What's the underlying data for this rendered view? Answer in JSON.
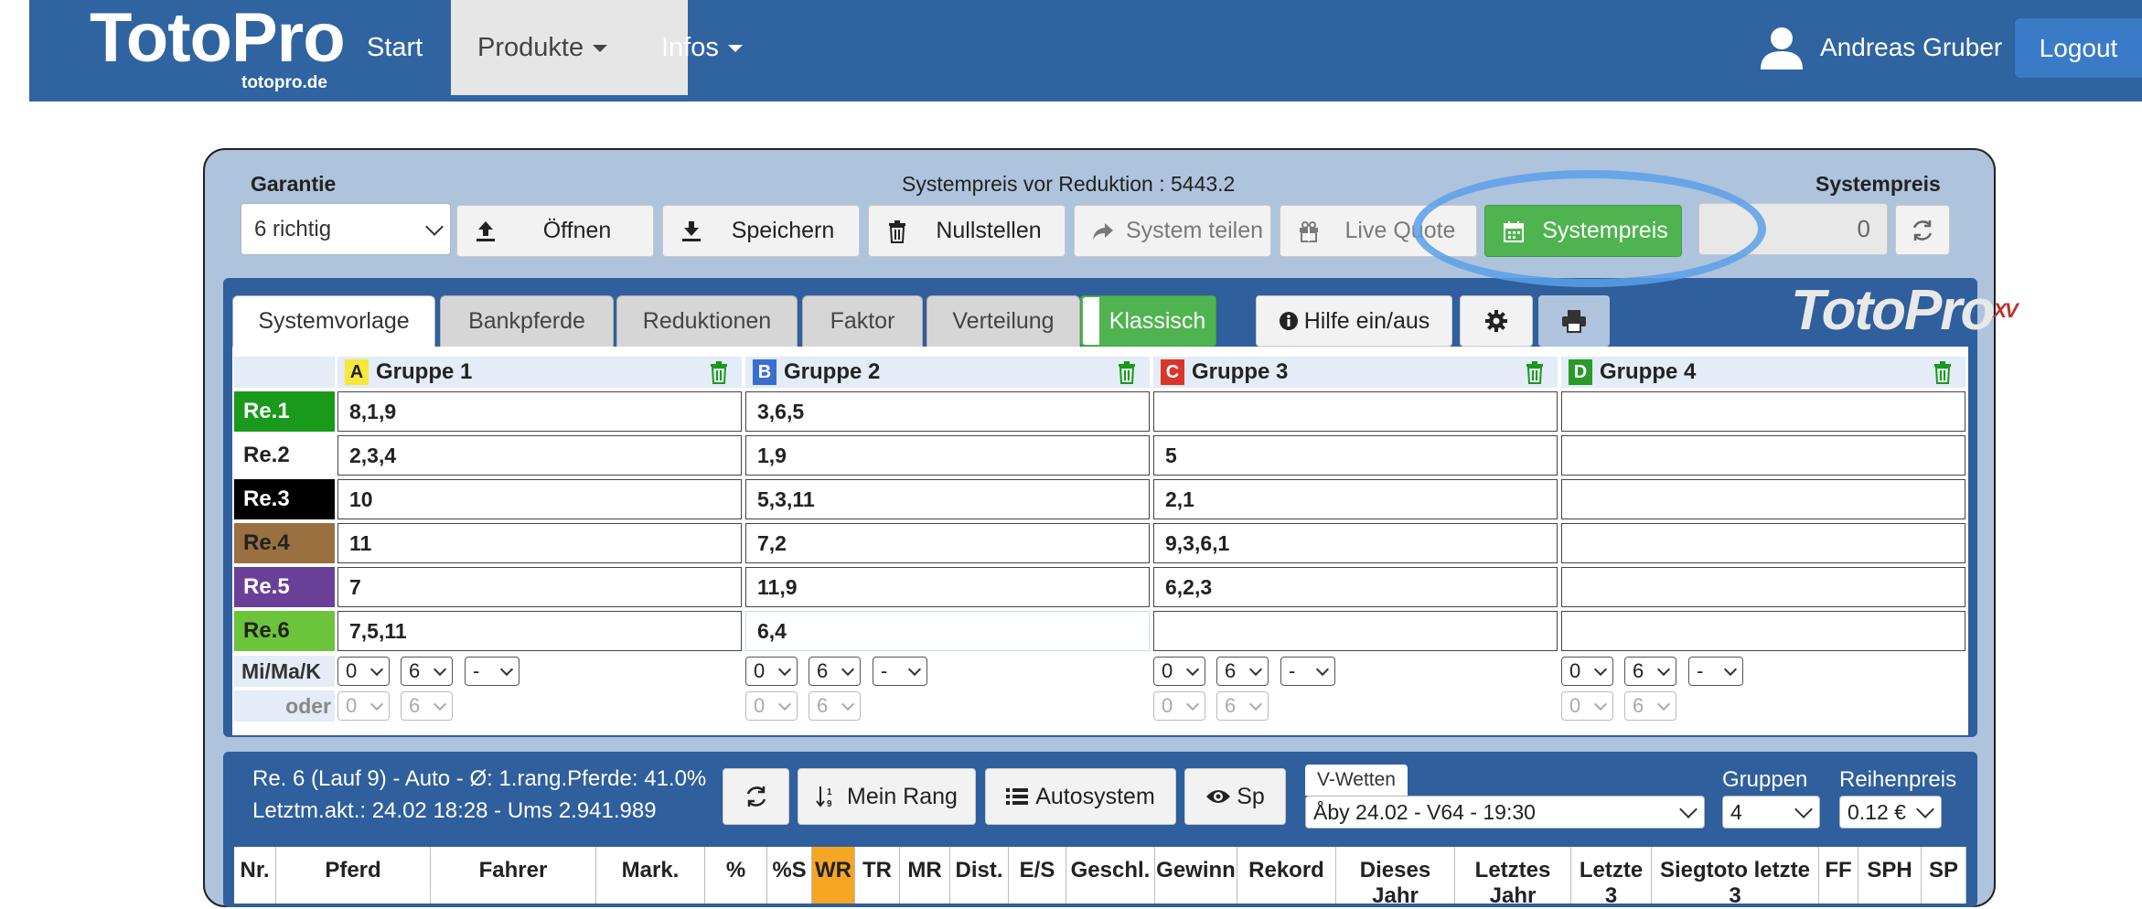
{
  "nav": {
    "brand": "TotoPro",
    "brand_sub": "totopro.de",
    "items": [
      {
        "label": "Start"
      },
      {
        "label": "Produkte"
      },
      {
        "label": "Infos"
      }
    ],
    "user_name": "Andreas Gruber",
    "logout_label": "Logout"
  },
  "toolbar": {
    "garantie_label": "Garantie",
    "garantie_value": "6 richtig",
    "systempreis_vor": "Systempreis vor Reduktion : 5443.2",
    "systempreis_label": "Systempreis",
    "systempreis_value": "0",
    "buttons": [
      {
        "label": "Öffnen"
      },
      {
        "label": "Speichern"
      },
      {
        "label": "Nullstellen"
      },
      {
        "label": "System teilen"
      },
      {
        "label": "Live Quote"
      },
      {
        "label": "Systempreis"
      }
    ]
  },
  "tabs": [
    {
      "label": "Systemvorlage"
    },
    {
      "label": "Bankpferde"
    },
    {
      "label": "Reduktionen"
    },
    {
      "label": "Faktor"
    },
    {
      "label": "Verteilung"
    }
  ],
  "toggle_label": "Klassisch",
  "hilfe_label": "Hilfe ein/aus",
  "logo_text": "TotoPro",
  "logo_sup": "XV",
  "groups": [
    {
      "letter": "A",
      "name": "Gruppe 1",
      "color": "#f5e83a",
      "text_color": "#222"
    },
    {
      "letter": "B",
      "name": "Gruppe 2",
      "color": "#3a6fd0",
      "text_color": "#fff"
    },
    {
      "letter": "C",
      "name": "Gruppe 3",
      "color": "#d9362b",
      "text_color": "#fff"
    },
    {
      "letter": "D",
      "name": "Gruppe 4",
      "color": "#2a9a2a",
      "text_color": "#fff"
    }
  ],
  "rows": [
    {
      "label": "Re.1",
      "bg": "#1a9a1a",
      "fg": "#ffffff",
      "cells": [
        "8,1,9",
        "3,6,5",
        "",
        ""
      ]
    },
    {
      "label": "Re.2",
      "bg": "#ffffff",
      "fg": "#222222",
      "cells": [
        "2,3,4",
        "1,9",
        "5",
        ""
      ]
    },
    {
      "label": "Re.3",
      "bg": "#000000",
      "fg": "#ffffff",
      "cells": [
        "10",
        "5,3,11",
        "2,1",
        ""
      ]
    },
    {
      "label": "Re.4",
      "bg": "#9a7040",
      "fg": "#222222",
      "cells": [
        "11",
        "7,2",
        "9,3,6,1",
        ""
      ]
    },
    {
      "label": "Re.5",
      "bg": "#6a3f98",
      "fg": "#ffffff",
      "cells": [
        "7",
        "11,9",
        "6,2,3",
        ""
      ]
    },
    {
      "label": "Re.6",
      "bg": "#6cc43a",
      "fg": "#222222",
      "cells": [
        "7,5,11",
        "6,4",
        "",
        ""
      ]
    }
  ],
  "mimak_label": "Mi/Ma/K",
  "oder_label": "oder",
  "mimak_values": [
    "0",
    "6",
    "-"
  ],
  "oder_values": [
    "0",
    "6"
  ],
  "bottom": {
    "info_line1": "Re. 6 (Lauf 9) - Auto - Ø: 1.rang.Pferde: 41.0%",
    "info_line2": "Letztm.akt.: 24.02 18:28 - Ums 2.941.989",
    "mein_rang_label": "Mein Rang",
    "autosystem_label": "Autosystem",
    "sp_label": "Sp",
    "vwetten_label": "V-Wetten",
    "vwetten_value": "Åby 24.02 - V64 - 19:30",
    "gruppen_label": "Gruppen",
    "gruppen_value": "4",
    "reihenpreis_label": "Reihenpreis",
    "reihenpreis_value": "0.12 €"
  },
  "table_headers": [
    "Nr.",
    "Pferd",
    "Fahrer",
    "Mark.",
    "%",
    "%S",
    "WR",
    "TR",
    "MR",
    "Dist.",
    "E/S",
    "Geschl.",
    "Gewinn",
    "Rekord",
    "Dieses Jahr",
    "Letztes Jahr",
    "Letzte 3",
    "Siegtoto letzte 3",
    "FF",
    "SPH",
    "SP"
  ],
  "wr_color": "#f5a623"
}
